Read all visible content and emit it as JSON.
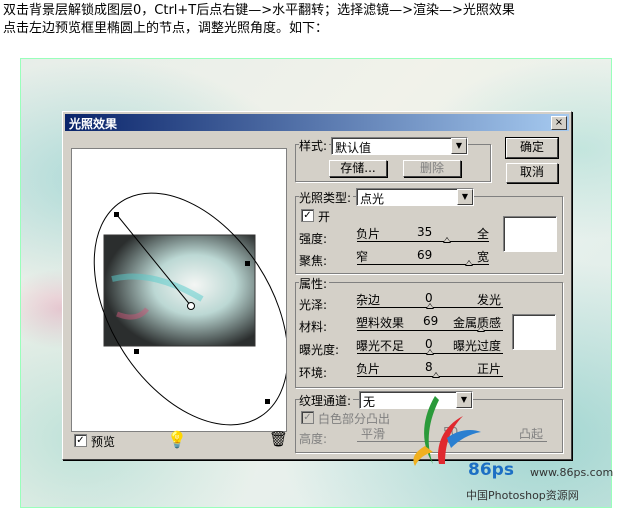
{
  "instructions": {
    "line1": "双击背景层解锁成图层0，Ctrl+T后点右键—>水平翻转；选择滤镜—>渲染—>光照效果",
    "line2": "点击左边预览框里椭圆上的节点，调整光照角度。如下："
  },
  "dialog": {
    "title": "光照效果",
    "close": "×",
    "style_label": "样式:",
    "style_value": "默认值",
    "save_button": "存储...",
    "delete_button": "删除",
    "ok_button": "确定",
    "cancel_button": "取消",
    "light_type_label": "光照类型:",
    "light_type_value": "点光",
    "on_label": "开",
    "on_checked": "✓",
    "intensity": {
      "label": "强度:",
      "left": "负片",
      "value": "35",
      "right": "全",
      "fraction": 0.68
    },
    "focus": {
      "label": "聚焦:",
      "left": "窄",
      "value": "69",
      "right": "宽",
      "fraction": 0.85
    },
    "properties_label": "属性:",
    "gloss": {
      "label": "光泽:",
      "left": "杂边",
      "value": "0",
      "right": "发光",
      "fraction": 0.5
    },
    "material": {
      "label": "材料:",
      "left": "塑料效果",
      "value": "69",
      "right": "金属质感",
      "fraction": 0.85
    },
    "exposure": {
      "label": "曝光度:",
      "left": "曝光不足",
      "value": "0",
      "right": "曝光过度",
      "fraction": 0.5
    },
    "ambience": {
      "label": "环境:",
      "left": "负片",
      "value": "8",
      "right": "正片",
      "fraction": 0.54
    },
    "texture_channel_label": "纹理通道:",
    "texture_channel_value": "无",
    "white_high_label": "白色部分凸出",
    "height": {
      "label": "高度:",
      "left": "平滑",
      "value": "50",
      "right": "凸起",
      "fraction": 0.5
    },
    "preview_label": "预览",
    "preview_checked": "✓",
    "bulb_icon": "light-bulb-icon",
    "trash_icon": "trash-icon"
  },
  "watermark": {
    "logo_text": "86ps",
    "url": "www.86ps.com",
    "site_name": "中国Photoshop资源网"
  }
}
